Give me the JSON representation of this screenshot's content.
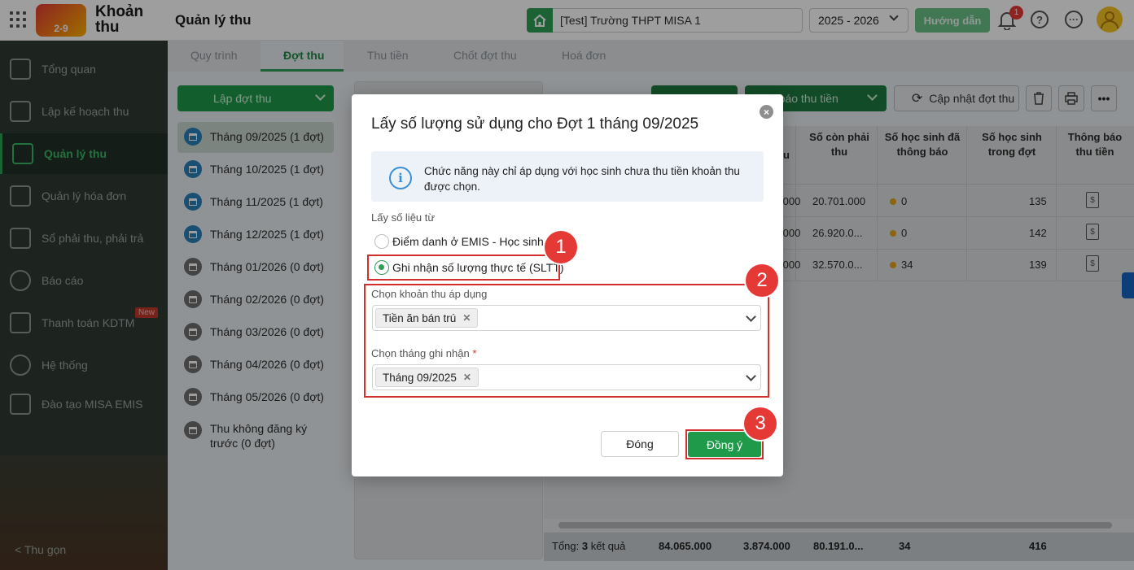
{
  "header": {
    "app_title": "Khoản thu",
    "logo_text": "2-9",
    "page_title": "Quản lý thu",
    "school": "[Test] Trường THPT MISA 1",
    "year": "2025 - 2026",
    "guide_label": "Hướng dẫn",
    "notification_count": "1",
    "help_label": "?",
    "more_label": "···"
  },
  "sidebar": {
    "items": [
      {
        "label": "Tổng quan",
        "icon": "chart-icon"
      },
      {
        "label": "Lập kế hoạch thu",
        "icon": "calendar-icon"
      },
      {
        "label": "Quản lý thu",
        "icon": "money-hand-icon"
      },
      {
        "label": "Quản lý hóa đơn",
        "icon": "invoice-icon"
      },
      {
        "label": "Sổ phải thu, phải trả",
        "icon": "ledger-icon"
      },
      {
        "label": "Báo cáo",
        "icon": "pie-chart-icon"
      },
      {
        "label": "Thanh toán KDTM",
        "icon": "card-icon"
      },
      {
        "label": "Hệ thống",
        "icon": "gear-icon"
      },
      {
        "label": "Đào tạo MISA EMIS",
        "icon": "book-icon"
      }
    ],
    "new_badge": "New",
    "collapse_label": "Thu gọn"
  },
  "tabs": [
    "Quy trình",
    "Đợt thu",
    "Thu tiền",
    "Chốt đợt thu",
    "Hoá đơn"
  ],
  "left": {
    "new_batch_label": "Lập đợt thu",
    "months": [
      "Tháng 09/2025 (1 đợt)",
      "Tháng 10/2025 (1 đợt)",
      "Tháng 11/2025 (1 đợt)",
      "Tháng 12/2025 (1 đợt)",
      "Tháng 01/2026 (0 đợt)",
      "Tháng 02/2026 (0 đợt)",
      "Tháng 03/2026 (0 đợt)",
      "Tháng 04/2026 (0 đợt)",
      "Tháng 05/2026 (0 đợt)",
      "Thu không đăng ký trước (0 đợt)"
    ]
  },
  "toolbar": {
    "notify_label": "g báo thu tiền",
    "update_label": "Cập nhật đợt thu",
    "more_label": "•••"
  },
  "table": {
    "headers": [
      "u",
      "Số còn phải thu",
      "Số học sinh đã thông báo",
      "Số học sinh trong đợt",
      "Thông báo thu tiền"
    ],
    "rows": [
      {
        "c0": ".000",
        "remaining": "20.701.000",
        "notified": "0",
        "students": "135"
      },
      {
        "c0": ".000",
        "remaining": "26.920.0...",
        "notified": "0",
        "students": "142"
      },
      {
        "c0": ".000",
        "remaining": "32.570.0...",
        "notified": "34",
        "students": "139"
      }
    ],
    "footer": {
      "label": "Tổng:",
      "count": "3",
      "suffix": "kết quả",
      "v1": "84.065.000",
      "v2": "3.874.000",
      "v3": "80.191.0...",
      "v4": "34",
      "v5": "416"
    }
  },
  "dialog": {
    "title": "Lấy số lượng sử dụng cho Đợt 1 tháng 09/2025",
    "info": "Chức năng này chỉ áp dụng với học sinh chưa thu tiền khoản thu được chọn.",
    "source_label": "Lấy số liệu từ",
    "option1": "Điểm danh ở EMIS - Học sinh",
    "option2": "Ghi nhận số lượng thực tế (SLTT)",
    "fee_label": "Chọn khoản thu áp dụng",
    "fee_value": "Tiền ăn bán trú",
    "month_label": "Chọn tháng ghi nhận",
    "required_mark": "*",
    "month_value": "Tháng 09/2025",
    "close_label": "Đóng",
    "ok_label": "Đồng ý",
    "step1": "1",
    "step2": "2",
    "step3": "3"
  },
  "colors": {
    "accent": "#2e9e55",
    "highlight": "#d32f2f",
    "sidebar": "#2f3a35"
  }
}
